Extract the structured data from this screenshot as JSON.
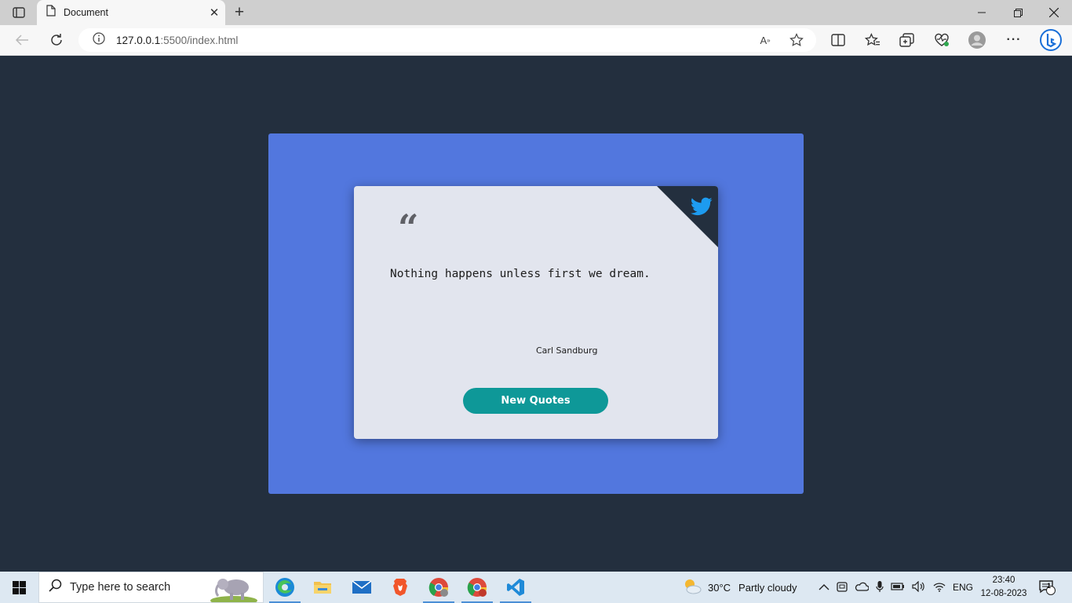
{
  "browser": {
    "tab_title": "Document",
    "url_host": "127.0.0.1",
    "url_path": ":5500/index.html",
    "icons": [
      "tab-actions-icon",
      "document-icon",
      "close-icon",
      "new-tab-icon",
      "minimize-icon",
      "restore-icon",
      "close-window-icon",
      "back-icon",
      "refresh-icon",
      "info-icon",
      "read-aloud-icon",
      "favorite-star-icon",
      "split-screen-icon",
      "favorites-icon",
      "collections-icon",
      "performance-icon",
      "profile-icon",
      "more-icon",
      "bing-icon"
    ]
  },
  "page": {
    "background": "#232f3e",
    "outer_color": "#5277de",
    "card_color": "#e2e5ee",
    "quote_mark": "“",
    "quote": "Nothing happens unless first we dream.",
    "author": "Carl Sandburg",
    "button_label": "New Quotes",
    "button_color": "#0e9898",
    "twitter_color": "#1d9bf0"
  },
  "taskbar": {
    "search_placeholder": "Type here to search",
    "apps": [
      "edge-icon",
      "file-explorer-icon",
      "mail-icon",
      "brave-icon",
      "chrome-icon",
      "chrome-profile-icon",
      "vscode-icon"
    ],
    "weather_temp": "30°C",
    "weather_desc": "Partly cloudy",
    "language": "ENG",
    "time": "23:40",
    "date": "12-08-2023",
    "notification_count": "1"
  }
}
